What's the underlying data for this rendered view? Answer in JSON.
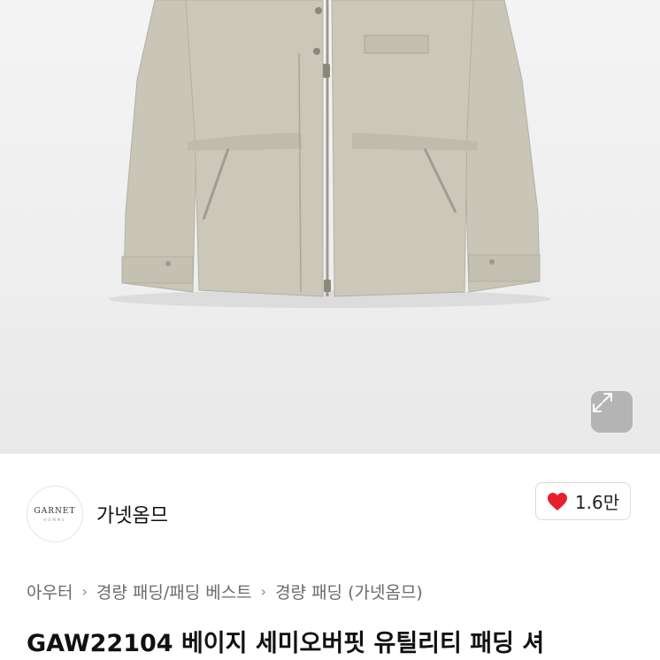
{
  "seller": {
    "logo_text": "GARNET",
    "logo_sub": "HOMME",
    "name": "가넷옴므"
  },
  "like": {
    "count": "1.6만",
    "heart_color": "#e8202b"
  },
  "breadcrumb": {
    "items": [
      "아우터",
      "경량 패딩/패딩 베스트",
      "경량 패딩 (가넷옴므)"
    ],
    "separator": "›"
  },
  "product": {
    "title": "GAW22104 베이지 세미오버핏 유틸리티 패딩 셔"
  },
  "icons": {
    "expand": "expand-icon",
    "like": "heart-icon"
  }
}
